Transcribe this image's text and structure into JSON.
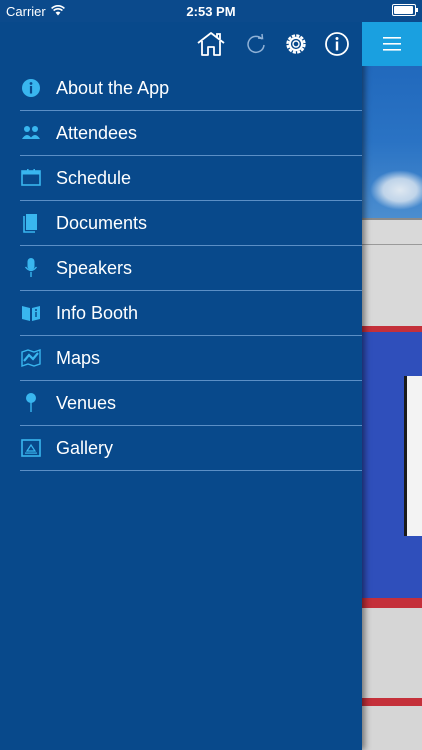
{
  "status_bar": {
    "carrier": "Carrier",
    "time": "2:53 PM"
  },
  "toolbar": {
    "icons": [
      "home-icon",
      "refresh-icon",
      "gear-icon",
      "info-icon"
    ]
  },
  "menu": {
    "items": [
      {
        "label": "About the App",
        "icon": "info-icon"
      },
      {
        "label": "Attendees",
        "icon": "attendees-icon"
      },
      {
        "label": "Schedule",
        "icon": "schedule-icon"
      },
      {
        "label": "Documents",
        "icon": "documents-icon"
      },
      {
        "label": "Speakers",
        "icon": "microphone-icon"
      },
      {
        "label": "Info Booth",
        "icon": "info-booth-icon"
      },
      {
        "label": "Maps",
        "icon": "map-icon"
      },
      {
        "label": "Venues",
        "icon": "pin-icon"
      },
      {
        "label": "Gallery",
        "icon": "gallery-icon"
      }
    ]
  },
  "colors": {
    "drawer_bg": "#08498b",
    "accent": "#1aa0e0",
    "icon_color": "#39b6ef",
    "divider": "#5b8fc6"
  }
}
